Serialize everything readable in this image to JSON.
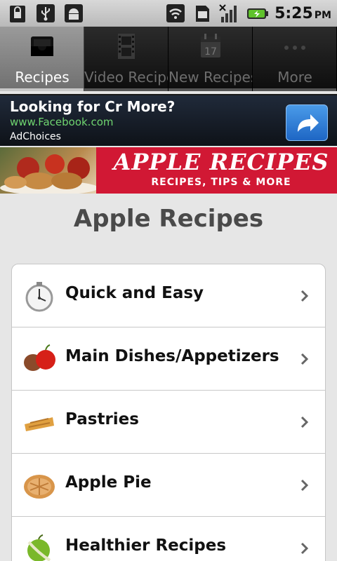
{
  "status_bar": {
    "left_icons": [
      "sim-lock-icon",
      "usb-icon",
      "android-debug-icon"
    ],
    "right_icons": [
      "wifi-icon",
      "sd-card-icon",
      "signal-off-icon",
      "battery-charging-icon"
    ],
    "time": "5:25",
    "ampm": "PM"
  },
  "tabs": [
    {
      "label": "Recipes",
      "icon": "drawer-icon",
      "active": true
    },
    {
      "label": "Video Recipes",
      "icon": "film-icon",
      "active": false
    },
    {
      "label": "New Recipes",
      "icon": "calendar-icon",
      "active": false
    },
    {
      "label": "More",
      "icon": "more-icon",
      "active": false
    }
  ],
  "calendar_day": "17",
  "ad": {
    "title": "Looking for Cr More?",
    "url": "www.Facebook.com",
    "choices": "AdChoices",
    "button_icon": "share-arrow-icon"
  },
  "hero": {
    "title": "APPLE RECIPES",
    "subtitle": "RECIPES, TIPS & MORE"
  },
  "page_title": "Apple Recipes",
  "list": [
    {
      "label": "Quick and Easy",
      "icon": "stopwatch-icon"
    },
    {
      "label": "Main Dishes/Appetizers",
      "icon": "apples-icon"
    },
    {
      "label": "Pastries",
      "icon": "pastry-icon"
    },
    {
      "label": "Apple Pie",
      "icon": "pie-icon"
    },
    {
      "label": "Healthier Recipes",
      "icon": "measuring-tape-apple-icon"
    }
  ],
  "colors": {
    "accent_red": "#d11834",
    "ad_button_blue": "#2f7fd8",
    "tab_active": "#8a8a8a"
  }
}
